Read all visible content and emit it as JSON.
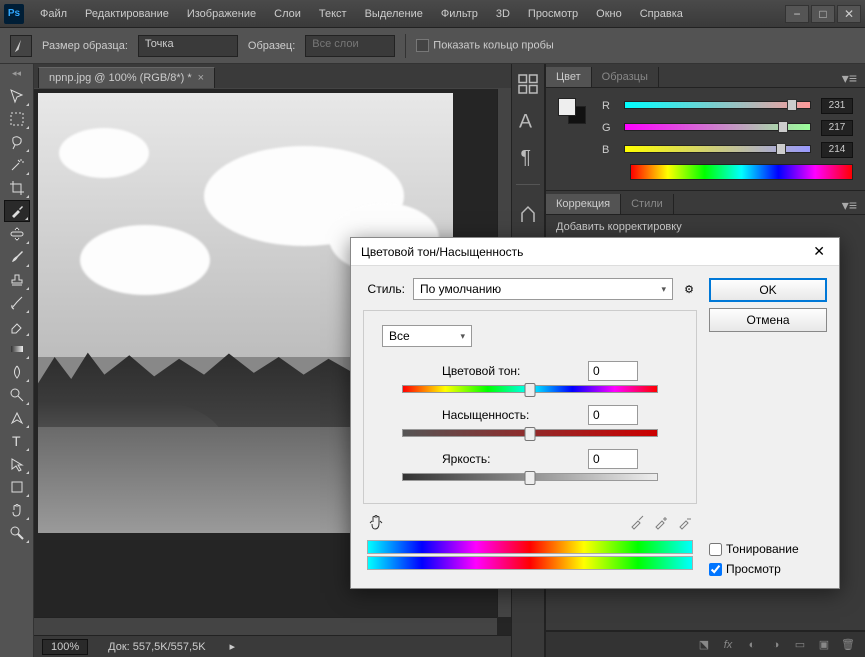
{
  "menu": [
    "Файл",
    "Редактирование",
    "Изображение",
    "Слои",
    "Текст",
    "Выделение",
    "Фильтр",
    "3D",
    "Просмотр",
    "Окно",
    "Справка"
  ],
  "options": {
    "sample_size_label": "Размер образца:",
    "sample_size_value": "Точка",
    "sample_label": "Образец:",
    "sample_value": "Все слои",
    "show_ring_label": "Показать кольцо пробы"
  },
  "doc": {
    "tab_title": "npnp.jpg @ 100% (RGB/8*) *",
    "zoom": "100%",
    "doc_info": "Док: 557,5K/557,5K"
  },
  "color_panel": {
    "tab_color": "Цвет",
    "tab_swatches": "Образцы",
    "r_label": "R",
    "r_val": "231",
    "g_label": "G",
    "g_val": "217",
    "b_label": "B",
    "b_val": "214"
  },
  "adjust_panel": {
    "tab_adjust": "Коррекция",
    "tab_styles": "Стили",
    "add_label": "Добавить корректировку"
  },
  "dialog": {
    "title": "Цветовой тон/Насыщенность",
    "style_label": "Стиль:",
    "style_value": "По умолчанию",
    "range_value": "Все",
    "hue_label": "Цветовой тон:",
    "hue_val": "0",
    "sat_label": "Насыщенность:",
    "sat_val": "0",
    "light_label": "Яркость:",
    "light_val": "0",
    "tint_label": "Тонирование",
    "preview_label": "Просмотр",
    "ok": "OK",
    "cancel": "Отмена"
  }
}
